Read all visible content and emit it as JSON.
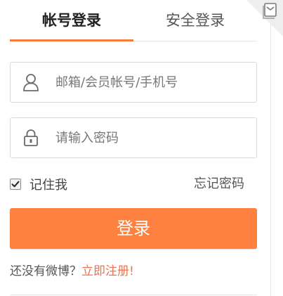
{
  "tabs": {
    "account_login": "帐号登录",
    "secure_login": "安全登录"
  },
  "form": {
    "username_placeholder": "邮箱/会员帐号/手机号",
    "password_placeholder": "请输入密码",
    "remember_label": "记住我",
    "remember_checked": true,
    "forgot_password": "忘记密码",
    "submit_label": "登录"
  },
  "register": {
    "prompt": "还没有微博？",
    "link": "立即注册!"
  },
  "icons": {
    "user": "user-icon",
    "lock": "lock-icon",
    "qr": "qrcode-icon",
    "check": "checkmark-icon"
  },
  "colors": {
    "accent": "#ff8140",
    "tab_underline": "#fa7d3c",
    "link": "#eb7350",
    "border": "#d9d9d9"
  }
}
